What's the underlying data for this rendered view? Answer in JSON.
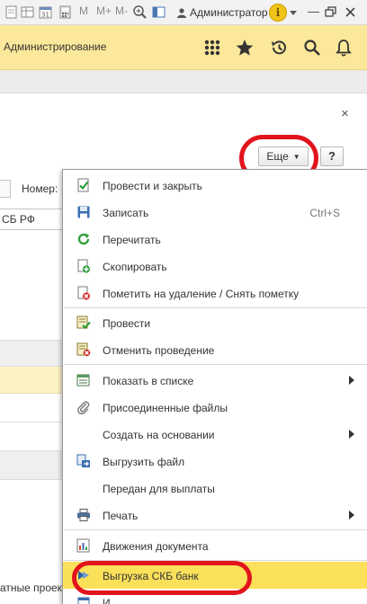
{
  "toolbar": {
    "memory_buttons": [
      "M",
      "M+",
      "M-"
    ],
    "user_name": "Администратор",
    "info_label": "i"
  },
  "header": {
    "section_title": "Администрирование"
  },
  "form": {
    "close_symbol": "×",
    "more_button_label": "Еще",
    "help_button_label": "?",
    "number_label": "Номер:",
    "bank_field_value": "СБ РФ",
    "bottom_text": "атные проек"
  },
  "menu": {
    "items": [
      {
        "label": "Провести и закрыть",
        "icon": "post-and-close-icon"
      },
      {
        "label": "Записать",
        "shortcut": "Ctrl+S",
        "icon": "save-disk-icon"
      },
      {
        "label": "Перечитать",
        "icon": "reread-icon"
      },
      {
        "label": "Скопировать",
        "icon": "copy-icon"
      },
      {
        "label": "Пометить на удаление / Снять пометку",
        "icon": "mark-delete-icon"
      },
      {
        "label": "Провести",
        "icon": "post-icon"
      },
      {
        "label": "Отменить проведение",
        "icon": "unpost-icon"
      },
      {
        "label": "Показать в списке",
        "icon": "show-in-list-icon",
        "submenu": true
      },
      {
        "label": "Присоединенные файлы",
        "icon": "paperclip-icon"
      },
      {
        "label": "Создать на основании",
        "submenu": true
      },
      {
        "label": "Выгрузить файл",
        "icon": "export-file-icon"
      },
      {
        "label": "Передан для выплаты"
      },
      {
        "label": "Печать",
        "icon": "printer-icon",
        "submenu": true
      },
      {
        "label": "Движения документа",
        "icon": "movements-icon"
      },
      {
        "label": "Выгрузка СКБ банк",
        "icon": "bank-export-icon",
        "highlighted": true
      },
      {
        "label": "И",
        "icon": "more-item-icon"
      }
    ]
  },
  "colors": {
    "header_yellow": "#fbe89a",
    "menu_highlight": "#fbe05a",
    "annotation_red": "#e2141c"
  }
}
